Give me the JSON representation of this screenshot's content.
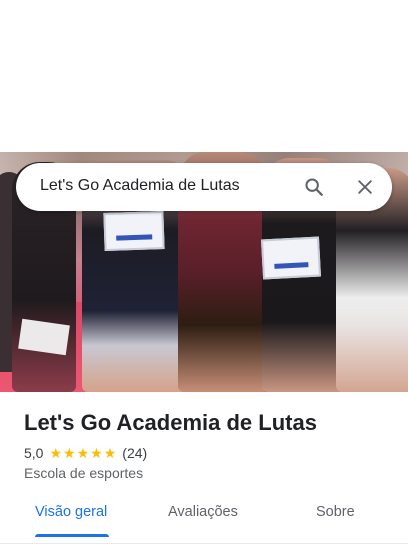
{
  "search": {
    "query": "Let's Go Academia de Lutas",
    "search_icon": "search-icon",
    "close_icon": "close-icon"
  },
  "photo": {
    "description_icon": "place-photo"
  },
  "place": {
    "name": "Let's Go Academia de Lutas",
    "rating": "5,0",
    "stars": 5,
    "review_count": "(24)",
    "category": "Escola de esportes"
  },
  "tabs": [
    {
      "label": "Visão geral",
      "active": true
    },
    {
      "label": "Avaliações",
      "active": false
    },
    {
      "label": "Sobre",
      "active": false
    }
  ],
  "colors": {
    "accent": "#1a73e8",
    "star": "#fbbc04",
    "text_primary": "#202124",
    "text_secondary": "#5f6368"
  }
}
